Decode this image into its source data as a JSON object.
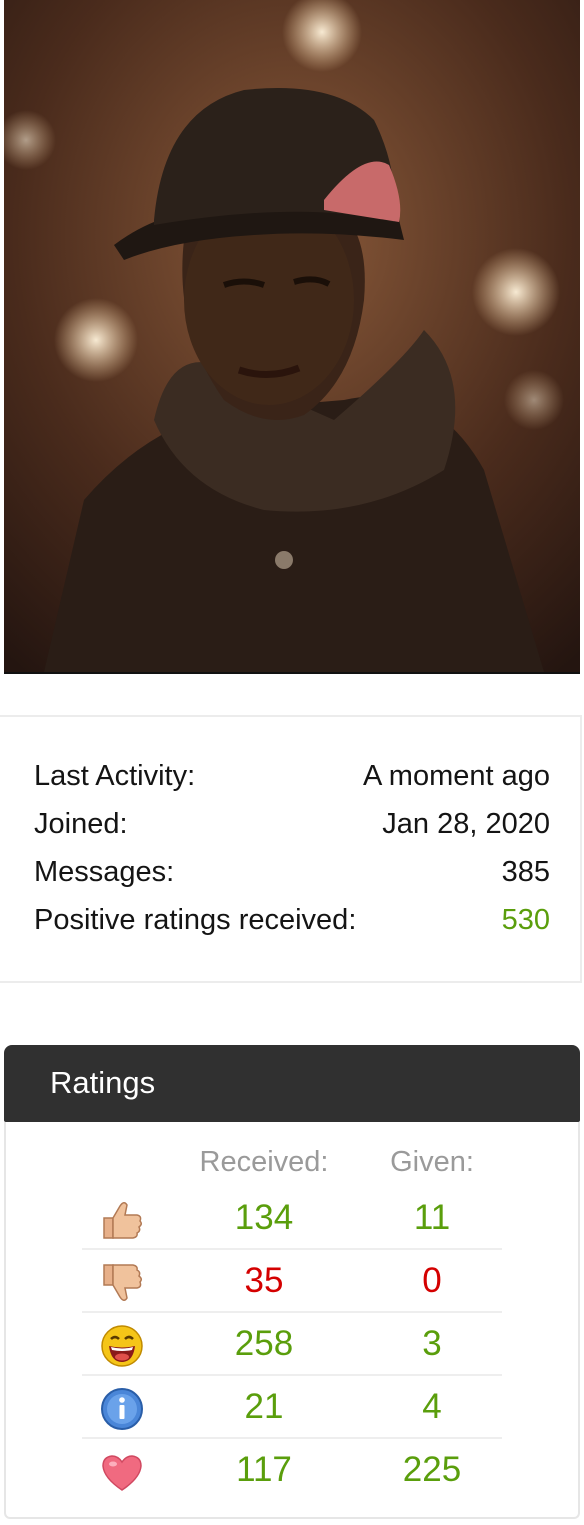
{
  "profile": {
    "avatar_alt": "Profile photo",
    "stats": [
      {
        "label": "Last Activity:",
        "value": "A moment ago",
        "positive": false
      },
      {
        "label": "Joined:",
        "value": "Jan 28, 2020",
        "positive": false
      },
      {
        "label": "Messages:",
        "value": "385",
        "positive": false
      },
      {
        "label": "Positive ratings received:",
        "value": "530",
        "positive": true
      }
    ]
  },
  "ratings": {
    "title": "Ratings",
    "received_label": "Received:",
    "given_label": "Given:",
    "rows": [
      {
        "icon": "thumbs-up-icon",
        "received": "134",
        "given": "11",
        "negative": false
      },
      {
        "icon": "thumbs-down-icon",
        "received": "35",
        "given": "0",
        "negative": true
      },
      {
        "icon": "laughing-face-icon",
        "received": "258",
        "given": "3",
        "negative": false
      },
      {
        "icon": "info-icon",
        "received": "21",
        "given": "4",
        "negative": false
      },
      {
        "icon": "heart-icon",
        "received": "117",
        "given": "225",
        "negative": false
      }
    ]
  },
  "colors": {
    "positive": "#5a9e0c",
    "negative": "#d40000",
    "header_bg": "#303030"
  }
}
